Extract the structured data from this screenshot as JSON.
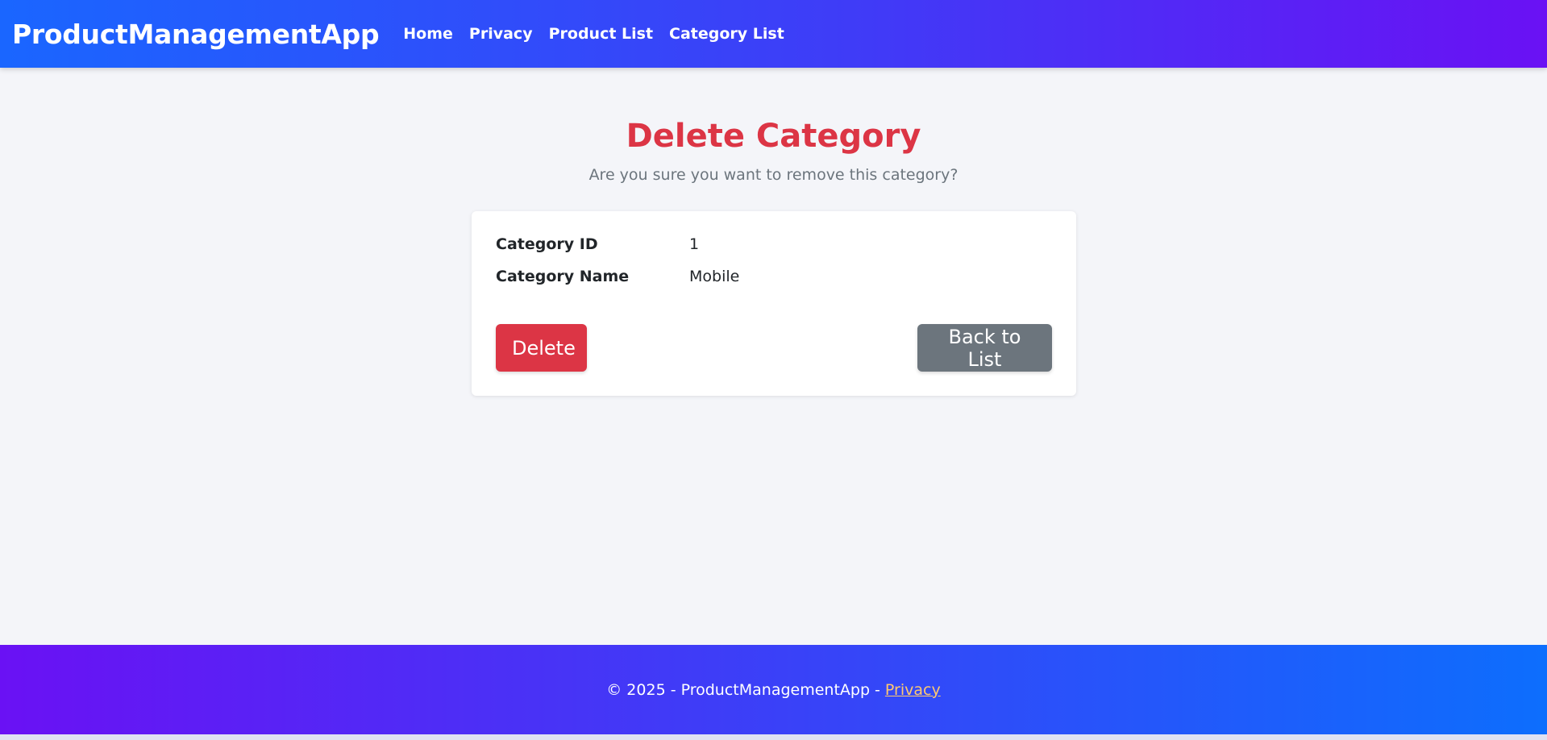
{
  "navbar": {
    "brand": "ProductManagementApp",
    "links": [
      {
        "label": "Home"
      },
      {
        "label": "Privacy"
      },
      {
        "label": "Product List"
      },
      {
        "label": "Category List"
      }
    ]
  },
  "main": {
    "title": "Delete Category",
    "subtitle": "Are you sure you want to remove this category?",
    "fields": [
      {
        "label": "Category ID",
        "value": "1"
      },
      {
        "label": "Category Name",
        "value": "Mobile"
      }
    ],
    "delete_label": "Delete",
    "back_label": "Back to List"
  },
  "footer": {
    "text": "© 2025 - ProductManagementApp -",
    "privacy_link": "Privacy"
  },
  "colors": {
    "danger": "#dc3545",
    "secondary": "#6c757d",
    "nav_gradient_start": "#1a66ff",
    "nav_gradient_end": "#6a11f4",
    "footer_link": "#ffc870"
  }
}
